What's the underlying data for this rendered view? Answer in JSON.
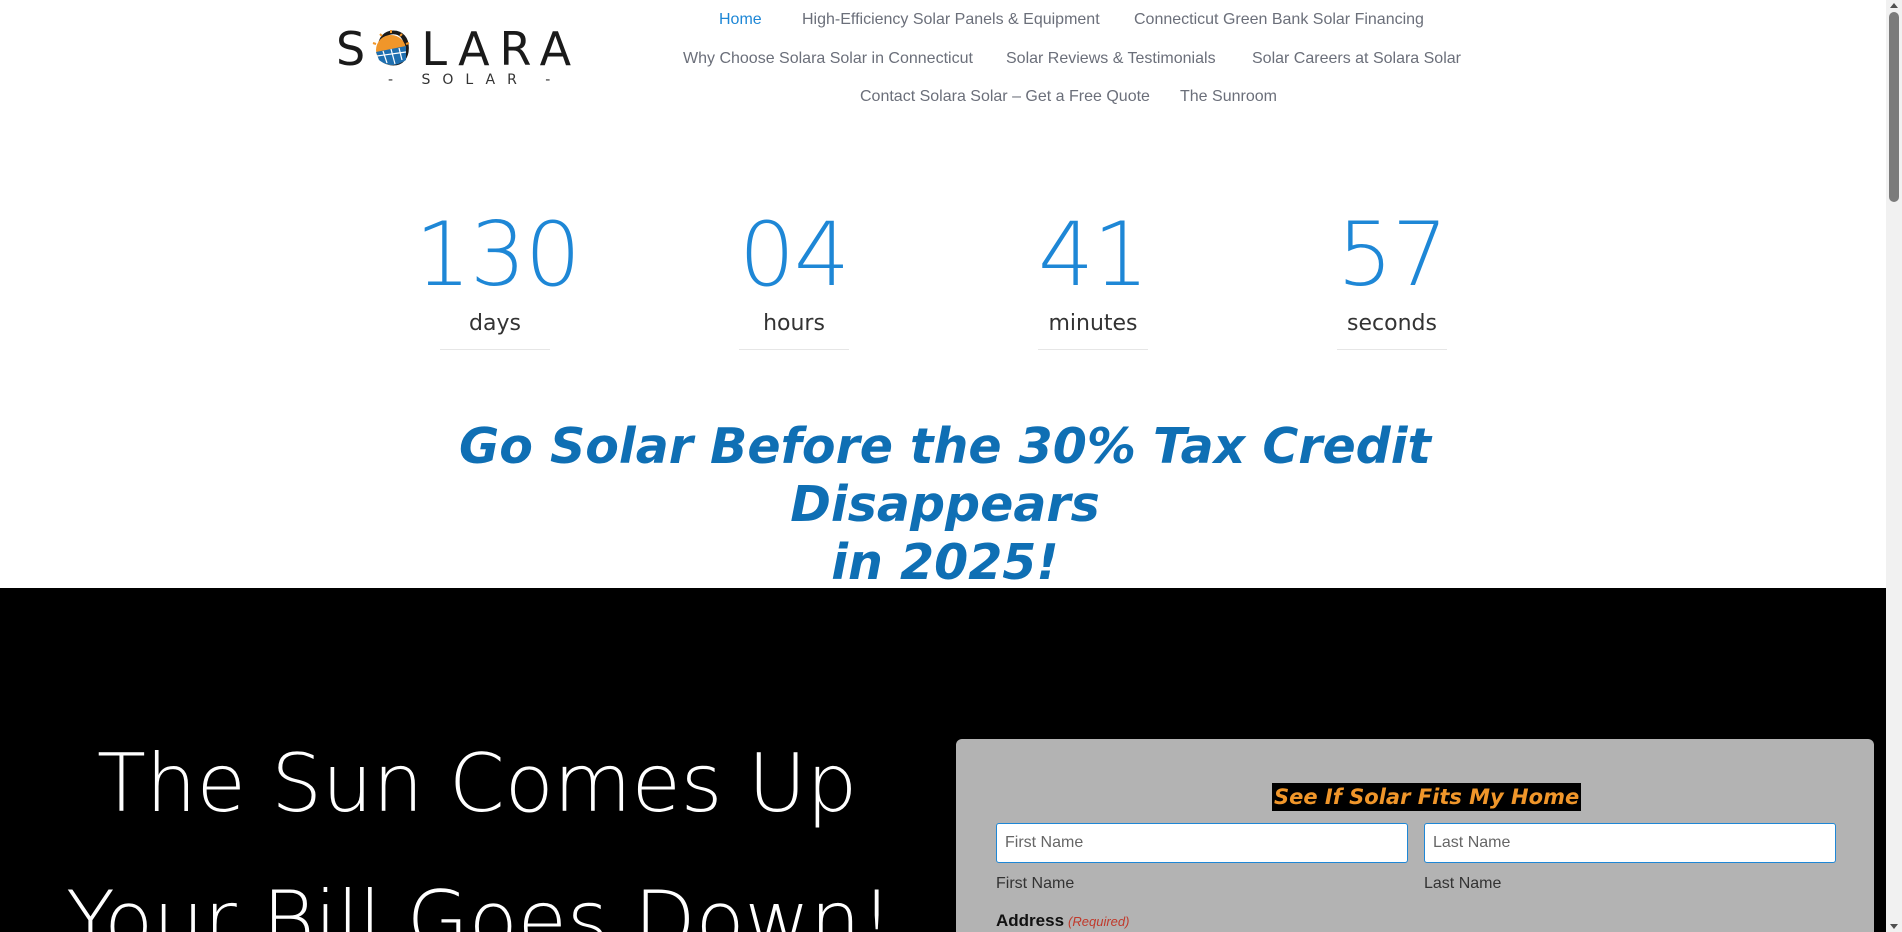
{
  "brand": {
    "logo_main": "SOLARA",
    "logo_sub": "- SOLAR -",
    "accent_color": "#1e87d6",
    "heading_color": "#0f6fb4",
    "cta_color": "#f0962a"
  },
  "nav": {
    "items": [
      {
        "label": "Home",
        "active": true
      },
      {
        "label": "High-Efficiency Solar Panels & Equipment"
      },
      {
        "label": "Connecticut Green Bank Solar Financing"
      },
      {
        "label": "Why Choose Solara Solar in Connecticut"
      },
      {
        "label": "Solar Reviews & Testimonials"
      },
      {
        "label": "Solar Careers at Solara Solar"
      },
      {
        "label": "Contact Solara Solar – Get a Free Quote"
      },
      {
        "label": "The Sunroom"
      }
    ]
  },
  "countdown": {
    "days": {
      "value": "130",
      "label": "days"
    },
    "hours": {
      "value": "04",
      "label": "hours"
    },
    "minutes": {
      "value": "41",
      "label": "minutes"
    },
    "seconds": {
      "value": "57",
      "label": "seconds"
    }
  },
  "headline": {
    "line1": "Go Solar Before the 30% Tax Credit Disappears",
    "line2": "in 2025!"
  },
  "hero": {
    "line1": "The Sun Comes Up",
    "line2": "Your Bill Goes Down!"
  },
  "form": {
    "title": "See If Solar Fits My Home",
    "first_name_placeholder": "First Name",
    "last_name_placeholder": "Last Name",
    "first_name_label": "First Name",
    "last_name_label": "Last Name",
    "address_label": "Address",
    "required_text": "(Required)"
  }
}
